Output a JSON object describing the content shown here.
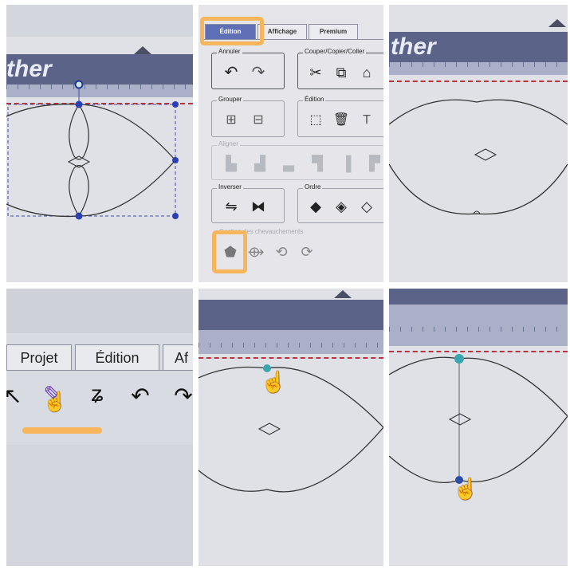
{
  "panel1": {
    "brand_fragment": "ther"
  },
  "panel2": {
    "tabs": [
      "Édition",
      "Affichage",
      "Premium"
    ],
    "groups": {
      "annuler": "Annuler",
      "couper": "Couper/Copier/Coller",
      "grouper": "Grouper",
      "edition": "Édition",
      "aligner": "Aligner",
      "inverser": "Inverser",
      "ordre": "Ordre",
      "chevauchement": "Gestion des chevauchements"
    },
    "highlights": [
      "Édition tab",
      "Gestion des chevauchements first tool"
    ],
    "accent_color": "#f7b55c"
  },
  "panel3": {
    "brand_fragment": "ther"
  },
  "panel4": {
    "tabs": [
      "Projet",
      "Édition",
      "Af"
    ],
    "highlight_color": "#f7b55c"
  },
  "icons": {
    "undo": "undo-icon",
    "redo": "redo-icon",
    "cut": "scissors-icon",
    "copy": "copy-icon",
    "delete": "trash-icon",
    "text": "text-icon",
    "hand": "hand-cursor-icon"
  }
}
